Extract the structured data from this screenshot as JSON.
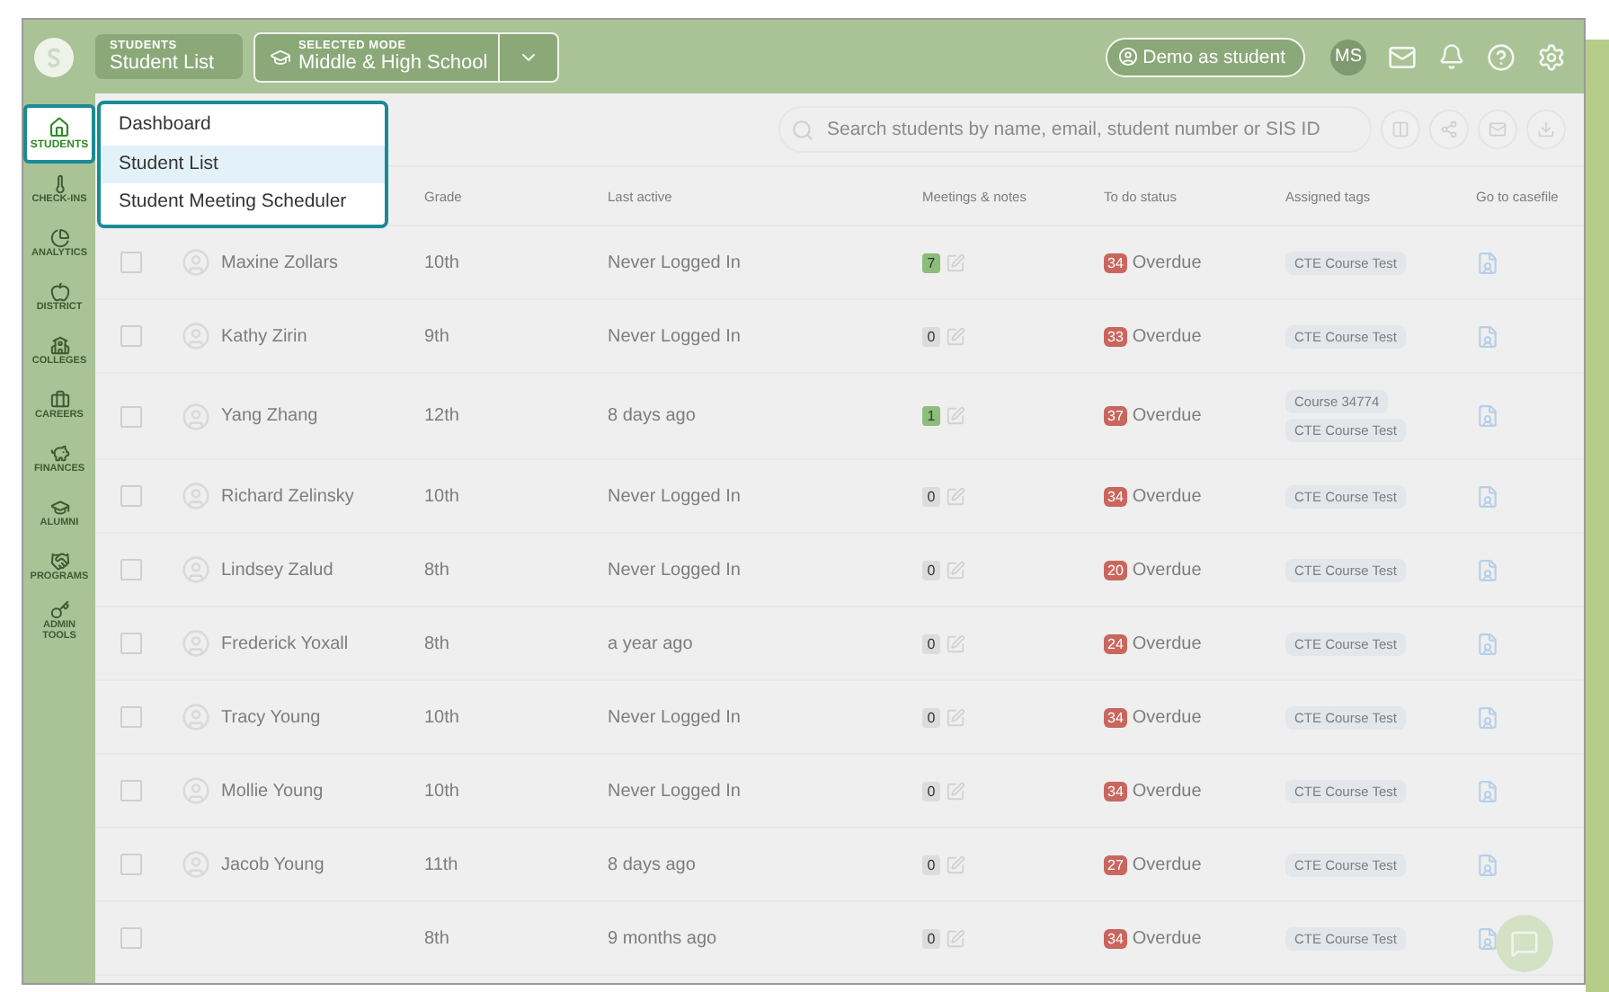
{
  "top_bar": {
    "section_label": "STUDENTS",
    "section_title": "Student List",
    "mode_label": "SELECTED MODE",
    "mode_value": "Middle & High School",
    "demo_button": "Demo as student",
    "avatar": "MS"
  },
  "sidebar": {
    "items": [
      {
        "label": "STUDENTS",
        "selected": true
      },
      {
        "label": "CHECK-INS",
        "selected": false
      },
      {
        "label": "ANALYTICS",
        "selected": false
      },
      {
        "label": "DISTRICT",
        "selected": false
      },
      {
        "label": "COLLEGES",
        "selected": false
      },
      {
        "label": "CAREERS",
        "selected": false
      },
      {
        "label": "FINANCES",
        "selected": false
      },
      {
        "label": "ALUMNI",
        "selected": false
      },
      {
        "label": "PROGRAMS",
        "selected": false
      },
      {
        "label": "ADMIN TOOLS",
        "selected": false
      }
    ]
  },
  "menu": {
    "items": [
      {
        "label": "Dashboard",
        "selected": false
      },
      {
        "label": "Student List",
        "selected": true
      },
      {
        "label": "Student Meeting Scheduler",
        "selected": false
      }
    ]
  },
  "search": {
    "placeholder": "Search students by name, email, student number or SIS ID"
  },
  "table": {
    "columns": [
      "Grade",
      "Last active",
      "Meetings & notes",
      "To do status",
      "Assigned tags",
      "Go to casefile"
    ],
    "rows": [
      {
        "checked": false,
        "name": "Maxine Zollars",
        "grade": "10th",
        "last_active": "Never Logged In",
        "meetings": {
          "count": "7",
          "color": "#8cbd7a"
        },
        "todo_count": "34",
        "todo_status": "Overdue",
        "tags": [
          "CTE Course Test"
        ]
      },
      {
        "checked": false,
        "name": "Kathy Zirin",
        "grade": "9th",
        "last_active": "Never Logged In",
        "meetings": {
          "count": "0",
          "color": "#dcdcdc"
        },
        "todo_count": "33",
        "todo_status": "Overdue",
        "tags": [
          "CTE Course Test"
        ]
      },
      {
        "checked": false,
        "name": "Yang Zhang",
        "grade": "12th",
        "last_active": "8 days ago",
        "meetings": {
          "count": "1",
          "color": "#8cbd7a"
        },
        "todo_count": "37",
        "todo_status": "Overdue",
        "tags": [
          "Course 34774",
          "CTE Course Test"
        ]
      },
      {
        "checked": false,
        "name": "Richard Zelinsky",
        "grade": "10th",
        "last_active": "Never Logged In",
        "meetings": {
          "count": "0",
          "color": "#dcdcdc"
        },
        "todo_count": "34",
        "todo_status": "Overdue",
        "tags": [
          "CTE Course Test"
        ]
      },
      {
        "checked": false,
        "name": "Lindsey Zalud",
        "grade": "8th",
        "last_active": "Never Logged In",
        "meetings": {
          "count": "0",
          "color": "#dcdcdc"
        },
        "todo_count": "20",
        "todo_status": "Overdue",
        "tags": [
          "CTE Course Test"
        ]
      },
      {
        "checked": false,
        "name": "Frederick Yoxall",
        "grade": "8th",
        "last_active": "a year ago",
        "meetings": {
          "count": "0",
          "color": "#dcdcdc"
        },
        "todo_count": "24",
        "todo_status": "Overdue",
        "tags": [
          "CTE Course Test"
        ]
      },
      {
        "checked": false,
        "name": "Tracy Young",
        "grade": "10th",
        "last_active": "Never Logged In",
        "meetings": {
          "count": "0",
          "color": "#dcdcdc"
        },
        "todo_count": "34",
        "todo_status": "Overdue",
        "tags": [
          "CTE Course Test"
        ]
      },
      {
        "checked": false,
        "name": "Mollie Young",
        "grade": "10th",
        "last_active": "Never Logged In",
        "meetings": {
          "count": "0",
          "color": "#dcdcdc"
        },
        "todo_count": "34",
        "todo_status": "Overdue",
        "tags": [
          "CTE Course Test"
        ]
      },
      {
        "checked": false,
        "name": "Jacob Young",
        "grade": "11th",
        "last_active": "8 days ago",
        "meetings": {
          "count": "0",
          "color": "#dcdcdc"
        },
        "todo_count": "27",
        "todo_status": "Overdue",
        "tags": [
          "CTE Course Test"
        ]
      },
      {
        "checked": false,
        "grade": "8th",
        "last_active": "9 months ago",
        "meetings": {
          "count": "0",
          "color": "#dcdcdc"
        },
        "todo_count": "34",
        "todo_status": "Overdue",
        "tags": [
          "CTE Course Test"
        ]
      }
    ]
  }
}
